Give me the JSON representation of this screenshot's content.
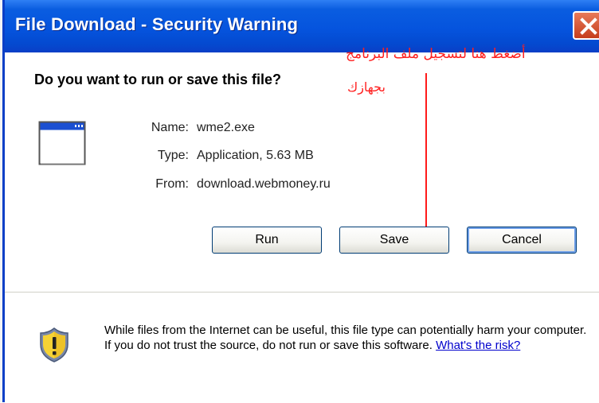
{
  "window": {
    "title": "File Download - Security Warning"
  },
  "dialog": {
    "question": "Do you want to run or save this file?",
    "file": {
      "name_label": "Name:",
      "name_value": "wme2.exe",
      "type_label": "Type:",
      "type_value": "Application, 5.63 MB",
      "from_label": "From:",
      "from_value": "download.webmoney.ru"
    },
    "buttons": {
      "run": "Run",
      "save": "Save",
      "cancel": "Cancel"
    },
    "warning": {
      "text": "While files from the Internet can be useful, this file type can potentially harm your computer. If you do not trust the source, do not run or save this software.",
      "link": "What's the risk?"
    }
  },
  "annotation": {
    "line1": "أضغط هنا لتسجيل ملف البرنامج",
    "line2": "بجهازك",
    "color": "#ff2020"
  },
  "colors": {
    "titlebar": "#0554de",
    "button_border": "#003c74"
  }
}
